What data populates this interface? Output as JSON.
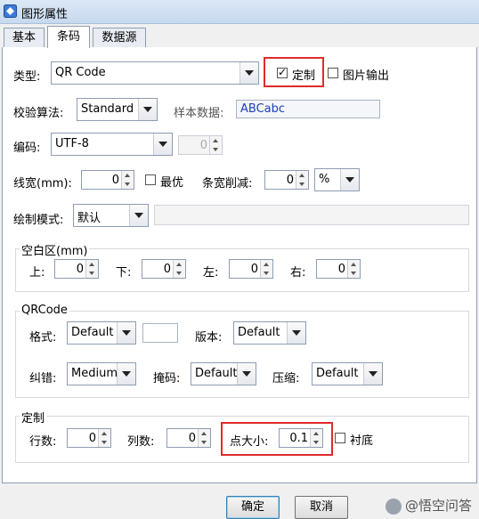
{
  "window": {
    "title": "图形属性"
  },
  "tabs": [
    "基本",
    "条码",
    "数据源"
  ],
  "row_type": {
    "label": "类型:",
    "value": "QR Code",
    "custom_label": "定制",
    "image_output_label": "图片输出"
  },
  "row_check": {
    "label": "校验算法:",
    "value": "Standard",
    "sample_label": "样本数据:",
    "sample_value": "ABCabc"
  },
  "row_encoding": {
    "label": "编码:",
    "value": "UTF-8",
    "spin_value": "0"
  },
  "row_linewidth": {
    "label": "线宽(mm):",
    "value": "0",
    "optimal_label": "最优",
    "reduce_label": "条宽削减:",
    "reduce_value": "0",
    "unit": "%"
  },
  "row_draw": {
    "label": "绘制模式:",
    "value": "默认"
  },
  "quiet_zone": {
    "title": "空白区(mm)",
    "top_label": "上:",
    "top": "0",
    "bottom_label": "下:",
    "bottom": "0",
    "left_label": "左:",
    "left": "0",
    "right_label": "右:",
    "right": "0"
  },
  "qrcode": {
    "title": "QRCode",
    "format_label": "格式:",
    "format": "Default",
    "version_label": "版本:",
    "version": "Default",
    "ecc_label": "纠错:",
    "ecc": "Medium",
    "mask_label": "掩码:",
    "mask": "Default",
    "compress_label": "压缩:",
    "compress": "Default"
  },
  "custom": {
    "title": "定制",
    "rows_label": "行数:",
    "rows": "0",
    "cols_label": "列数:",
    "cols": "0",
    "dot_label": "点大小:",
    "dot": "0.1",
    "background_label": "衬底"
  },
  "buttons": {
    "ok": "确定",
    "cancel": "取消"
  },
  "watermark": "@悟空问答",
  "colors": {
    "highlight": "#e02b2b",
    "sample_text": "#1a3fb5"
  }
}
